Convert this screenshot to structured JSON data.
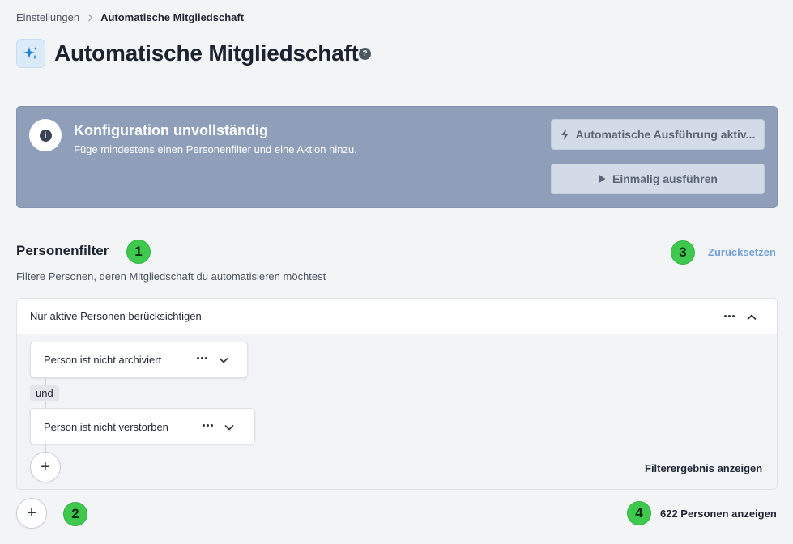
{
  "breadcrumb": {
    "parent": "Einstellungen",
    "current": "Automatische Mitgliedschaft"
  },
  "header": {
    "title": "Automatische Mitgliedschaft",
    "help_glyph": "?",
    "icon": "sparkles-icon"
  },
  "banner": {
    "info_glyph": "i",
    "title": "Konfiguration unvollständig",
    "subtitle": "Füge mindestens einen Personenfilter und eine Aktion hinzu.",
    "auto_button": "Automatische Ausführung aktiv...",
    "once_button": "Einmalig ausführen",
    "background_color": "#8f9fba"
  },
  "section": {
    "title": "Personenfilter",
    "subtitle": "Filtere Personen, deren Mitgliedschaft du automatisieren möchtest",
    "reset_label": "Zurücksetzen"
  },
  "badges": [
    "1",
    "2",
    "3",
    "4"
  ],
  "filter_group": {
    "label": "Nur aktive Personen berücksichtigen",
    "rules": [
      {
        "label": "Person ist nicht archiviert"
      },
      {
        "label": "Person ist nicht verstorben"
      }
    ],
    "conjunction": "und",
    "add_glyph": "+",
    "result_label": "Filterergebnis anzeigen"
  },
  "footer": {
    "add_glyph": "+",
    "persons_label": "622 Personen anzeigen"
  },
  "colors": {
    "accent_badge": "#3ec94e",
    "link": "#6f9fd8"
  }
}
